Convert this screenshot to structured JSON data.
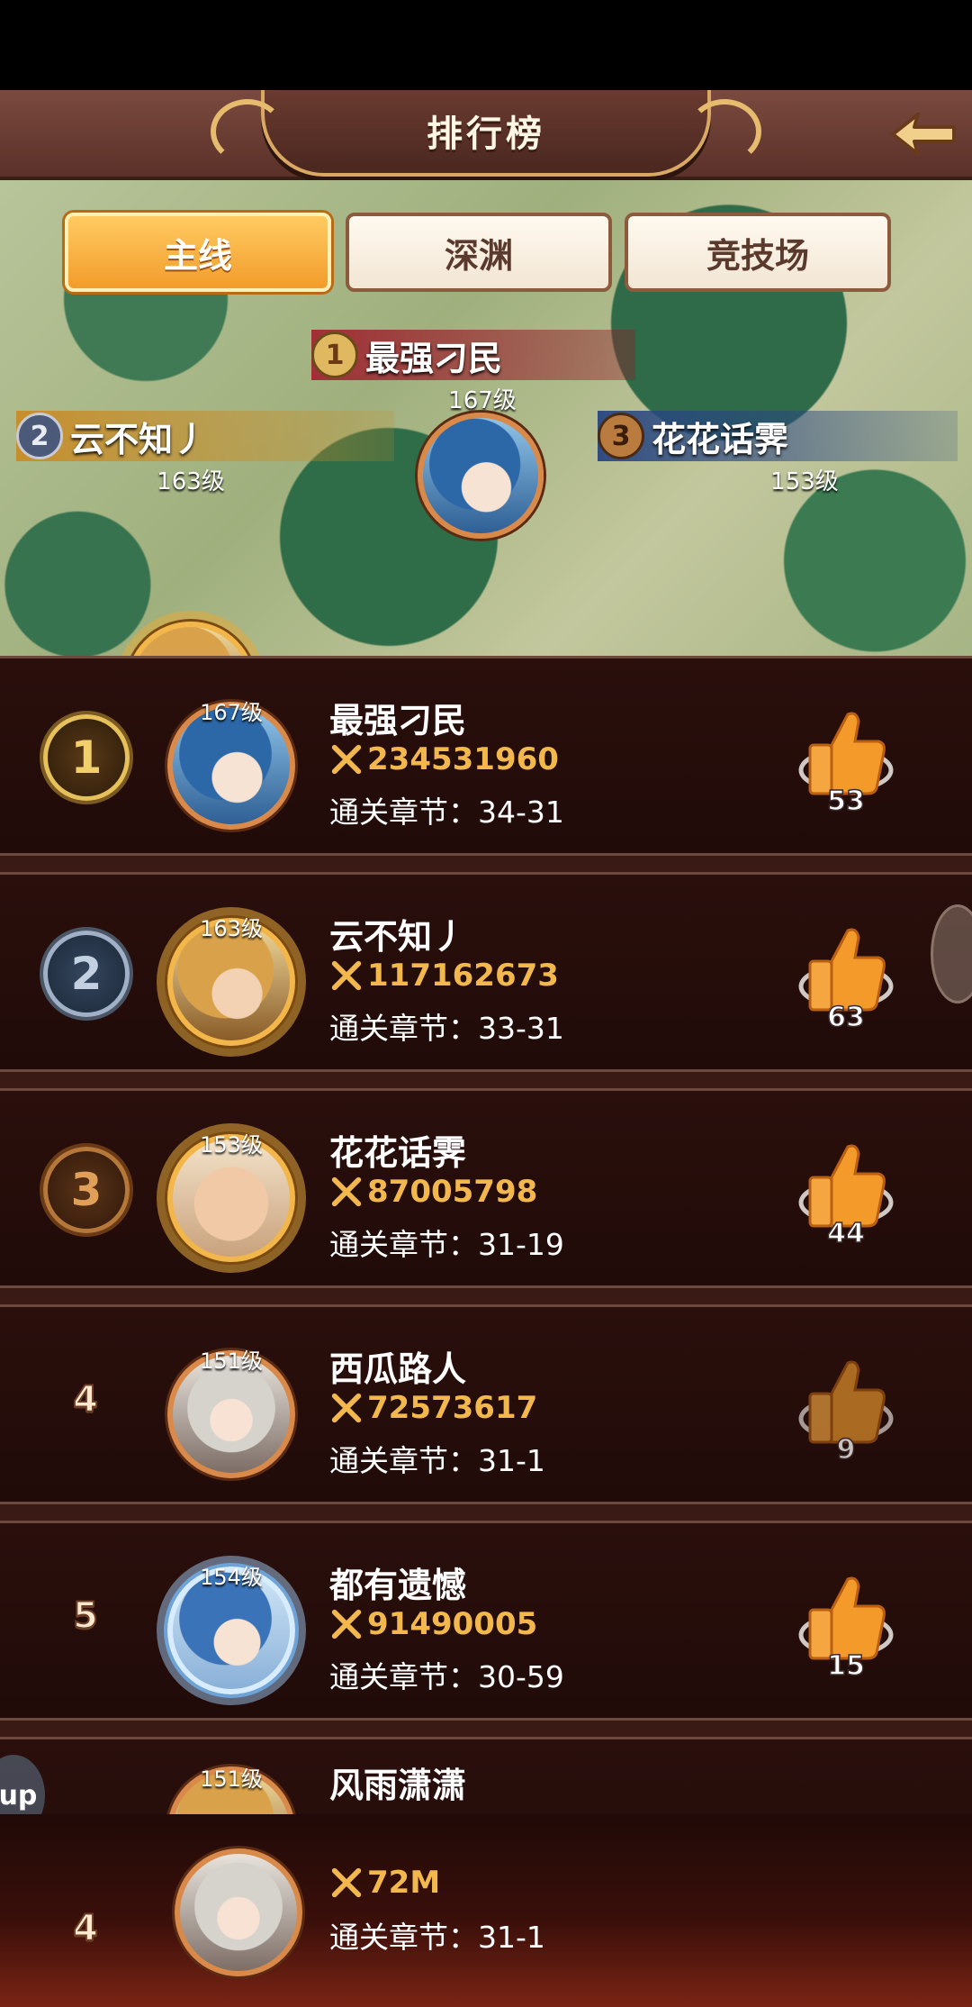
{
  "header": {
    "title": "排行榜"
  },
  "tabs": [
    {
      "label": "主线",
      "active": true
    },
    {
      "label": "深渊",
      "active": false
    },
    {
      "label": "竞技场",
      "active": false
    }
  ],
  "podium": [
    {
      "rank": "1",
      "name": "最强刁民",
      "level": "167级"
    },
    {
      "rank": "2",
      "name": "云不知丿",
      "level": "163级"
    },
    {
      "rank": "3",
      "name": "花花话霁",
      "level": "153级"
    }
  ],
  "ranking": [
    {
      "rank": "1",
      "level": "167级",
      "name": "最强刁民",
      "power": "234531960",
      "chapter": "通关章节：34-31",
      "likes": "53"
    },
    {
      "rank": "2",
      "level": "163级",
      "name": "云不知丿",
      "power": "117162673",
      "chapter": "通关章节：33-31",
      "likes": "63"
    },
    {
      "rank": "3",
      "level": "153级",
      "name": "花花话霁",
      "power": "87005798",
      "chapter": "通关章节：31-19",
      "likes": "44"
    },
    {
      "rank": "4",
      "level": "151级",
      "name": "西瓜路人",
      "power": "72573617",
      "chapter": "通关章节：31-1",
      "likes": "9"
    },
    {
      "rank": "5",
      "level": "154级",
      "name": "都有遗憾",
      "power": "91490005",
      "chapter": "通关章节：30-59",
      "likes": "15"
    },
    {
      "rank": "",
      "level": "151级",
      "name": "风雨潇潇",
      "power": "",
      "chapter": "",
      "likes": ""
    }
  ],
  "self": {
    "rank": "4",
    "power": "72M",
    "chapter": "通关章节：31-1"
  },
  "side_left_label": "up",
  "colors": {
    "accent_orange": "#f29c2a",
    "power_gold": "#f2b84d",
    "panel_bg": "#2a0f0c"
  }
}
